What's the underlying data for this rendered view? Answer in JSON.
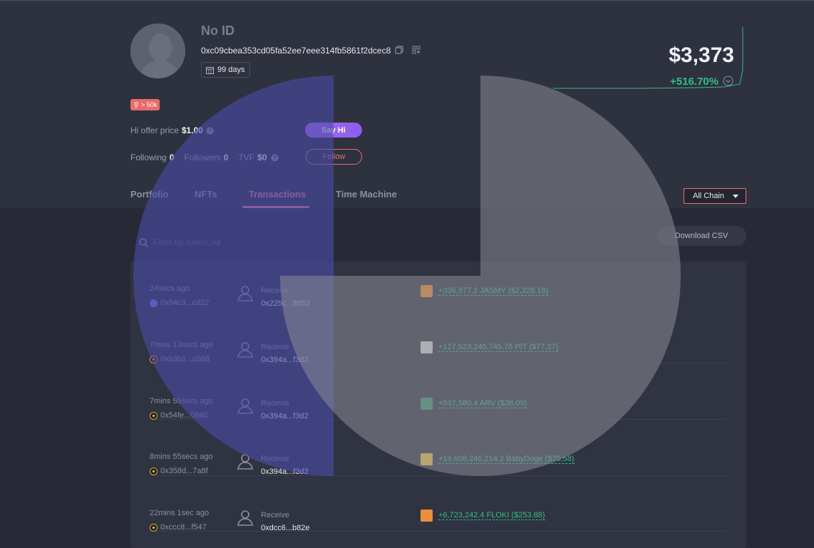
{
  "profile": {
    "name": "No ID",
    "address": "0xc09cbea353cd05fa52ee7eee314fb5861f2dcec8",
    "days": "99 days",
    "rank_badge": "> 50k",
    "net_worth": "$3,373",
    "change": "+516.70%"
  },
  "offer": {
    "label": "Hi offer price",
    "value": "$1.00",
    "say_hi": "Say Hi"
  },
  "social": {
    "following_label": "Following",
    "following": "0",
    "followers_label": "Followers",
    "followers": "0",
    "tvf_label": "TVF",
    "tvf": "$0",
    "follow_button": "Follow"
  },
  "tabs": [
    {
      "label": "Portfolio"
    },
    {
      "label": "NFTs"
    },
    {
      "label": "Transactions"
    },
    {
      "label": "Time Machine"
    }
  ],
  "chain_select": "All Chain",
  "filter_placeholder": "Filter by token: All",
  "download_csv": "Download CSV",
  "transactions": [
    {
      "time": "24secs ago",
      "hash": "0x04c3...cd22",
      "chain": "eth",
      "type": "Receive",
      "address": "0x225c...8853",
      "amount": "+336,977.2 JASMY ($2,328.18)",
      "token": "jasmy-icon",
      "token_color": "#f08a2e"
    },
    {
      "time": "7mins 13secs ago",
      "hash": "0xb3b1...c088",
      "chain": "bsc",
      "type": "Receive",
      "address": "0x394a...f3d2",
      "amount": "+127,523,248,745.76 PIT ($77.37)",
      "token": "pit-icon",
      "token_color": "#d9d9d9"
    },
    {
      "time": "7mins 55secs ago",
      "hash": "0x54fe...0840",
      "chain": "bsc",
      "type": "Receive",
      "address": "0x394a...f3d2",
      "amount": "+537,580.4 ARV ($38.09)",
      "token": "arv-icon",
      "token_color": "#3a9a6a"
    },
    {
      "time": "8mins 55secs ago",
      "hash": "0x358d...7a8f",
      "chain": "bsc",
      "type": "Receive",
      "address": "0x394a...f3d2",
      "amount": "+19,608,246,214.2 BabyDoge ($70.58)",
      "token": "babydoge-icon",
      "token_color": "#f2c24a"
    },
    {
      "time": "22mins 1sec ago",
      "hash": "0xccc8...f547",
      "chain": "bsc",
      "type": "Receive",
      "address": "0xdcc6...b82e",
      "amount": "+6,723,242.4 FLOKI ($253.88)",
      "token": "floki-icon",
      "token_color": "#e8913a"
    }
  ],
  "colors": {
    "accent": "#ea7a84",
    "positive": "#2fbf8a",
    "say_hi": "#a465f1"
  }
}
